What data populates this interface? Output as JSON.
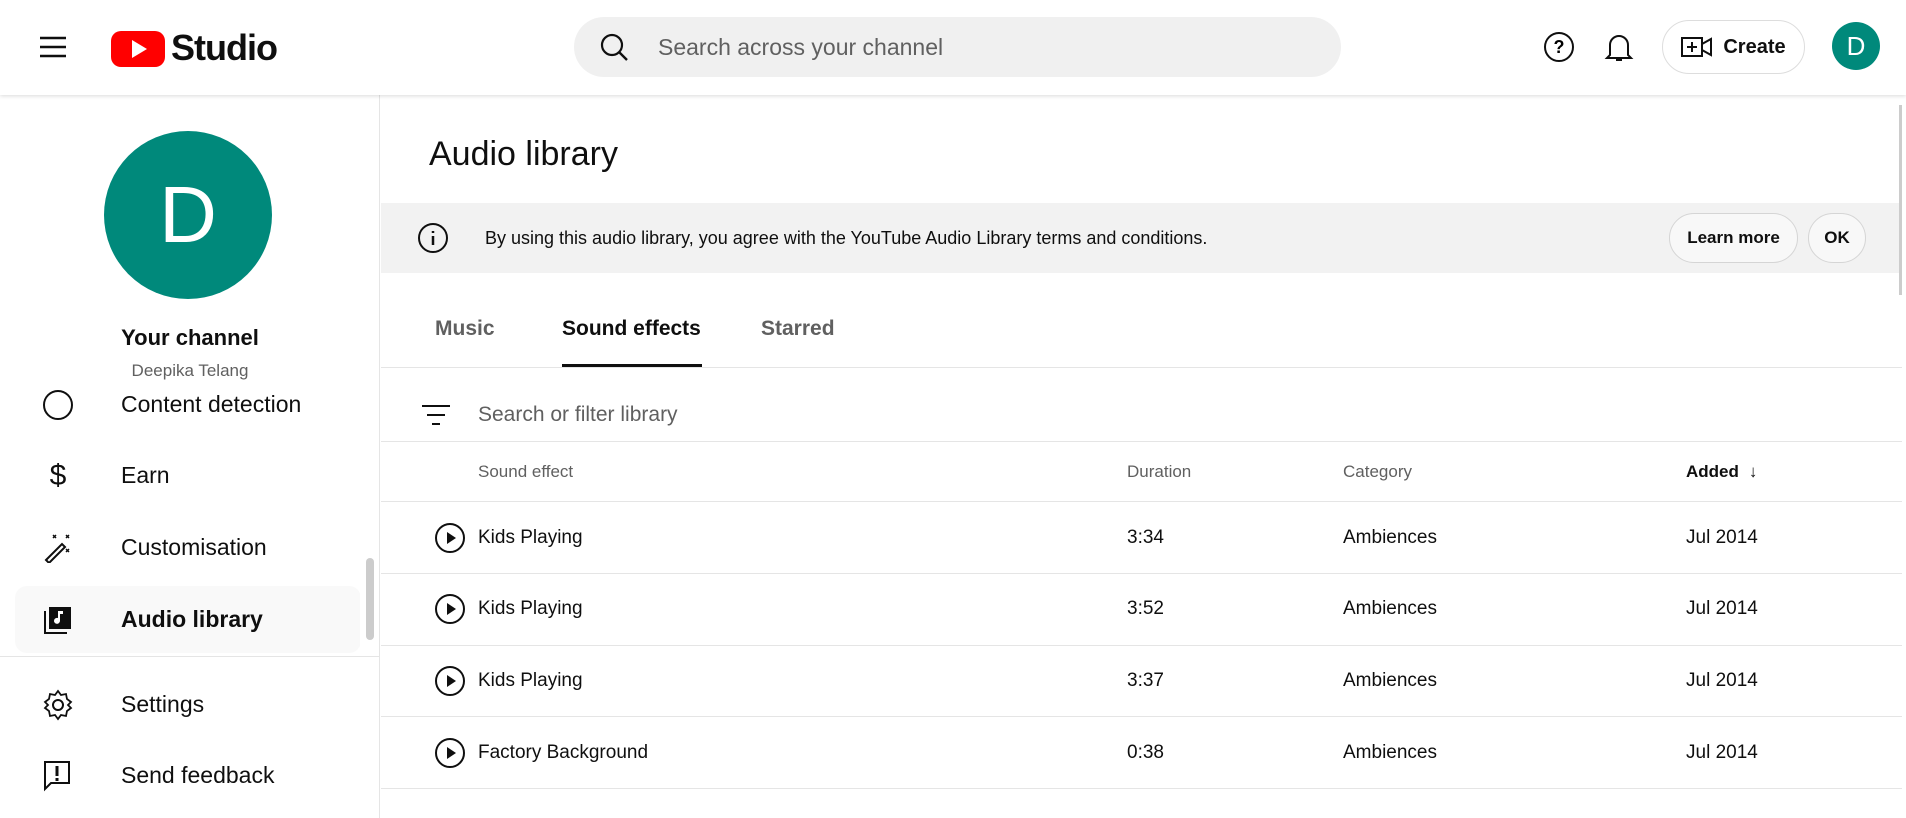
{
  "header": {
    "logo_text": "Studio",
    "search_placeholder": "Search across your channel",
    "create_label": "Create",
    "avatar_letter": "D"
  },
  "sidebar": {
    "avatar_letter": "D",
    "channel_title": "Your channel",
    "channel_name": "Deepika Telang",
    "items": [
      {
        "label": "Content detection"
      },
      {
        "label": "Earn"
      },
      {
        "label": "Customisation"
      },
      {
        "label": "Audio library"
      },
      {
        "label": "Settings"
      },
      {
        "label": "Send feedback"
      }
    ]
  },
  "main": {
    "title": "Audio library",
    "banner": {
      "text": "By using this audio library, you agree with the YouTube Audio Library terms and conditions.",
      "learn_more": "Learn more",
      "ok": "OK"
    },
    "tabs": [
      {
        "label": "Music"
      },
      {
        "label": "Sound effects"
      },
      {
        "label": "Starred"
      }
    ],
    "filter_placeholder": "Search or filter library",
    "columns": {
      "name": "Sound effect",
      "duration": "Duration",
      "category": "Category",
      "added": "Added"
    },
    "rows": [
      {
        "name": "Kids Playing",
        "duration": "3:34",
        "category": "Ambiences",
        "added": "Jul 2014"
      },
      {
        "name": "Kids Playing",
        "duration": "3:52",
        "category": "Ambiences",
        "added": "Jul 2014"
      },
      {
        "name": "Kids Playing",
        "duration": "3:37",
        "category": "Ambiences",
        "added": "Jul 2014"
      },
      {
        "name": "Factory Background",
        "duration": "0:38",
        "category": "Ambiences",
        "added": "Jul 2014"
      }
    ]
  },
  "colors": {
    "brand_red": "#ff0000",
    "avatar": "#00897b"
  }
}
